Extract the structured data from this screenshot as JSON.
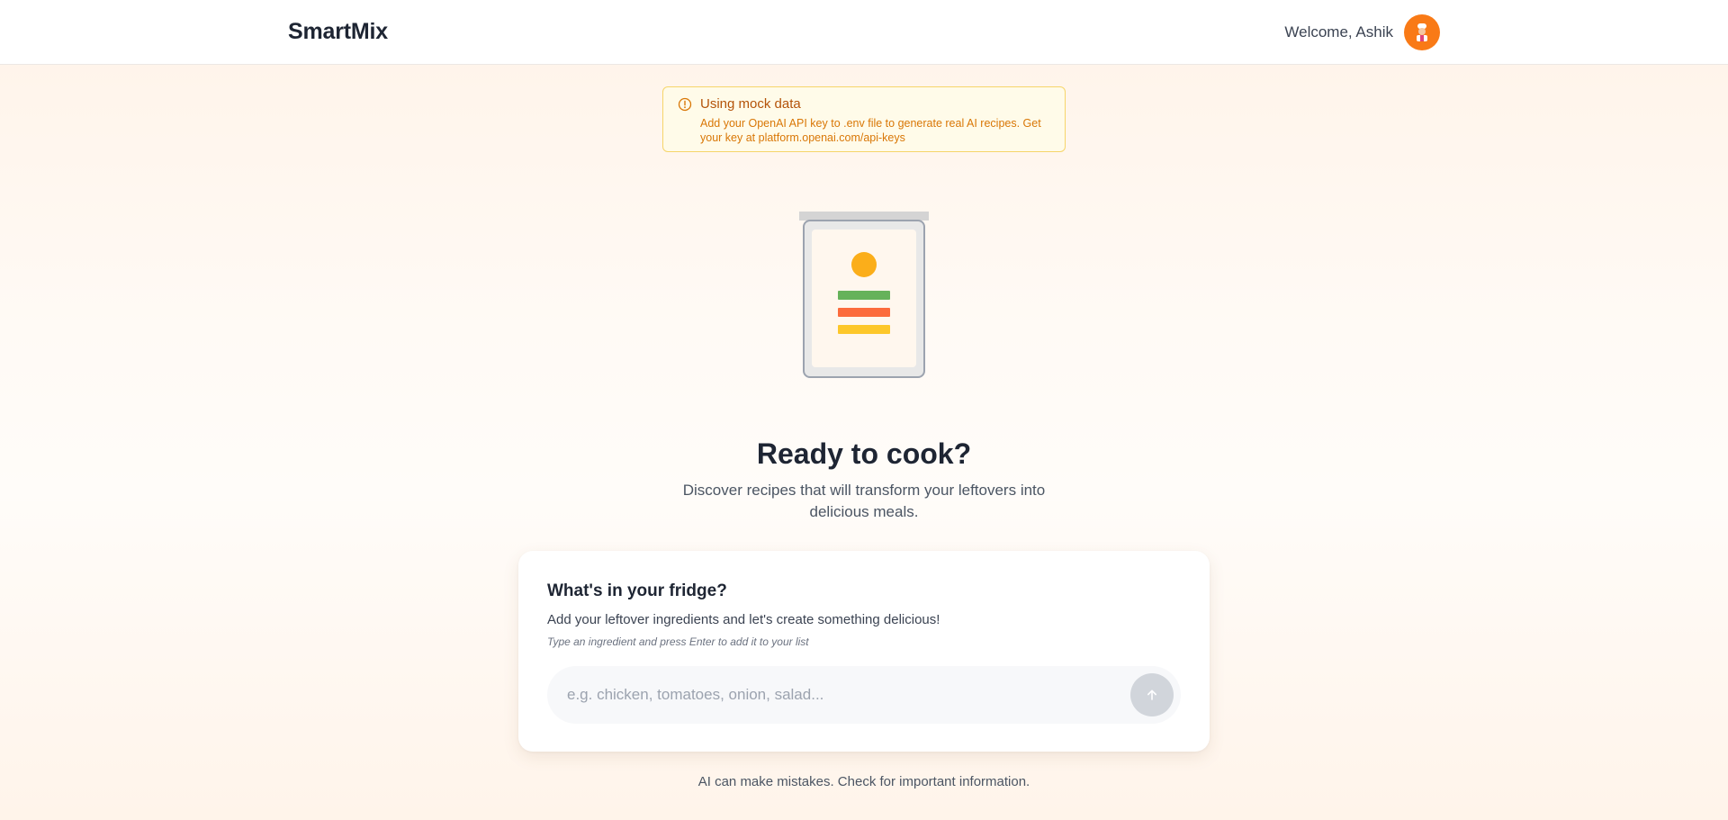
{
  "header": {
    "brand": "SmartMix",
    "welcome": "Welcome, Ashik",
    "avatar_icon": "chef-avatar-icon"
  },
  "notice": {
    "icon": "info-circle-icon",
    "title": "Using mock data",
    "body": "Add your OpenAI API key to .env file to generate real AI recipes. Get your key at platform.openai.com/api-keys"
  },
  "hero": {
    "illustration": "recipe-tablet-illustration",
    "title": "Ready to cook?",
    "subtitle": "Discover recipes that will transform your leftovers into delicious meals."
  },
  "fridge_card": {
    "title": "What's in your fridge?",
    "description": "Add your leftover ingredients and let's create something delicious!",
    "hint": "Type an ingredient and press Enter to add it to your list",
    "input": {
      "value": "",
      "placeholder": "e.g. chicken, tomatoes, onion, salad..."
    },
    "submit_icon": "arrow-up-icon"
  },
  "footer": {
    "disclaimer": "AI can make mistakes. Check for important information."
  },
  "colors": {
    "accent": "#f97a16",
    "notice_border": "#f6d56a",
    "notice_text": "#d97706"
  }
}
